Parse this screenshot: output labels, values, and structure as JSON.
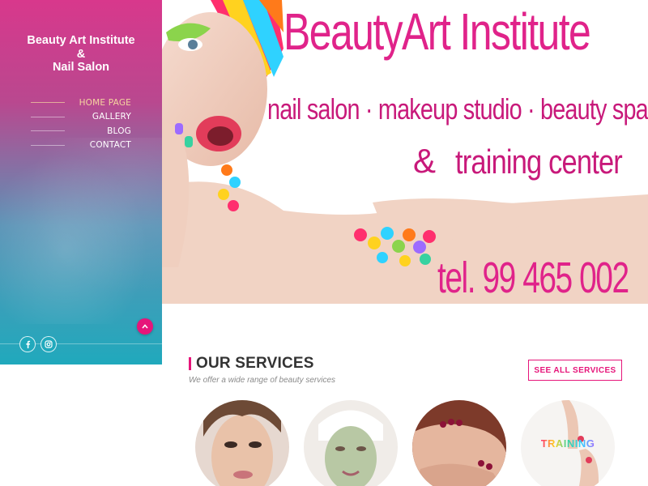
{
  "sidebar": {
    "brand_line1": "Beauty Art Institute",
    "brand_line2": "&",
    "brand_line3": "Nail Salon",
    "menu": [
      {
        "label": "HOME PAGE",
        "active": true
      },
      {
        "label": "GALLERY",
        "active": false
      },
      {
        "label": "BLOG",
        "active": false
      },
      {
        "label": "CONTACT",
        "active": false
      }
    ],
    "social": [
      {
        "icon": "facebook-icon",
        "glyph": "f"
      },
      {
        "icon": "instagram-icon",
        "glyph": "◙"
      }
    ],
    "scroll_top_icon": "chevron-up-icon"
  },
  "hero": {
    "title": "BeautyArt Institute",
    "subtitle": "nail salon · makeup studio · beauty spa",
    "amp": "&",
    "line3": "training center",
    "tel": "tel. 99 465 002"
  },
  "services": {
    "title": "OUR SERVICES",
    "subtitle": "We offer a wide range of beauty services",
    "see_all_label": "SEE ALL SERVICES",
    "items": [
      {
        "icon": "makeup-image"
      },
      {
        "icon": "facial-mask-image"
      },
      {
        "icon": "pedicure-image"
      },
      {
        "icon": "training-image",
        "label": "TRAINING"
      }
    ]
  },
  "colors": {
    "accent": "#e6157a",
    "sidebar_top": "#d8388c",
    "sidebar_bottom": "#20a9bc",
    "hero_text": "#d61b7f"
  }
}
